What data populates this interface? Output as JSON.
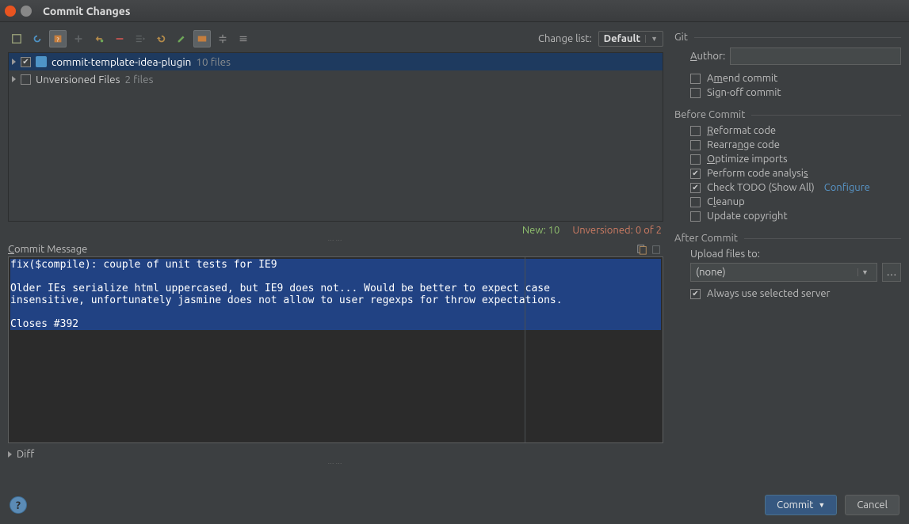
{
  "window": {
    "title": "Commit Changes"
  },
  "toolbar": {
    "change_list_label": "Change list:",
    "change_list_value": "Default"
  },
  "tree": {
    "items": [
      {
        "name": "commit-template-idea-plugin",
        "count": "10 files",
        "checked": true,
        "selected": true
      },
      {
        "name": "Unversioned Files",
        "count": "2 files",
        "checked": false,
        "selected": false
      }
    ]
  },
  "status": {
    "new_label": "New:",
    "new_count": "10",
    "unversioned_label": "Unversioned:",
    "unversioned_count": "0 of 2"
  },
  "commit_message": {
    "label": "Commit Message",
    "text_lines": [
      "fix($compile): couple of unit tests for IE9",
      "",
      "Older IEs serialize html uppercased, but IE9 does not... Would be better to expect case",
      "insensitive, unfortunately jasmine does not allow to user regexps for throw expectations.",
      "",
      "Closes #392"
    ]
  },
  "diff": {
    "label": "Diff"
  },
  "git": {
    "title": "Git",
    "author_label": "Author:",
    "author_value": "",
    "amend_label": "Amend commit",
    "signoff_label": "Sign-off commit",
    "amend_checked": false,
    "signoff_checked": false
  },
  "before_commit": {
    "title": "Before Commit",
    "items": [
      {
        "label": "Reformat code",
        "checked": false
      },
      {
        "label": "Rearrange code",
        "checked": false
      },
      {
        "label": "Optimize imports",
        "checked": false
      },
      {
        "label": "Perform code analysis",
        "checked": true
      },
      {
        "label": "Check TODO (Show All)",
        "checked": true,
        "configure": "Configure"
      },
      {
        "label": "Cleanup",
        "checked": false
      },
      {
        "label": "Update copyright",
        "checked": false
      }
    ]
  },
  "after_commit": {
    "title": "After Commit",
    "upload_label": "Upload files to:",
    "upload_value": "(none)",
    "always_label": "Always use selected server",
    "always_checked": true
  },
  "footer": {
    "commit_label": "Commit",
    "cancel_label": "Cancel"
  }
}
